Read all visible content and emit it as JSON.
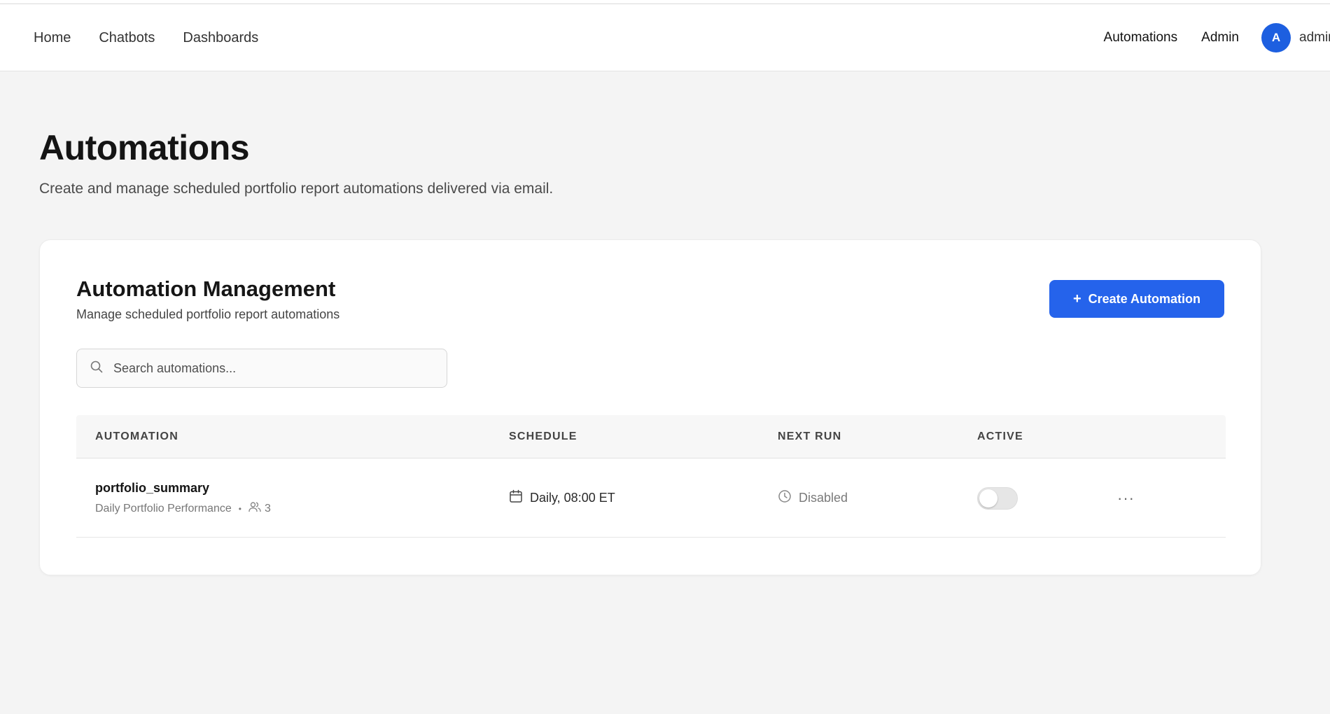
{
  "nav": {
    "left_links": [
      "Home",
      "Chatbots",
      "Dashboards"
    ],
    "automations": "Automations",
    "admin": "Admin",
    "avatar_initial": "A",
    "user_name": "admin"
  },
  "page": {
    "title": "Automations",
    "subtitle": "Create and manage scheduled portfolio report automations delivered via email."
  },
  "card": {
    "title": "Automation Management",
    "subtitle": "Manage scheduled portfolio report automations",
    "create_button": "Create Automation",
    "search_placeholder": "Search automations..."
  },
  "table": {
    "headers": [
      "AUTOMATION",
      "SCHEDULE",
      "NEXT RUN",
      "ACTIVE"
    ],
    "rows": [
      {
        "name": "portfolio_summary",
        "description": "Daily Portfolio Performance",
        "recipients": "3",
        "schedule": "Daily, 08:00 ET",
        "next_run": "Disabled",
        "active": false
      }
    ]
  },
  "colors": {
    "accent": "#2563eb",
    "avatar": "#1d5fe0",
    "page_bg": "#f4f4f4"
  }
}
